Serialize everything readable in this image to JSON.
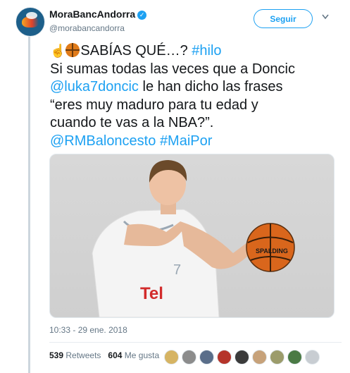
{
  "author": {
    "display_name": "MoraBancAndorra",
    "handle": "@morabancandorra",
    "verified_icon": "verified-badge-icon"
  },
  "follow_label": "Seguir",
  "tweet": {
    "line1_text": "SABÍAS QUÉ…?",
    "line1_hashtag": "#hilo",
    "line2": "Si sumas todas las veces que a Doncic",
    "line3_mention": "@luka7doncic",
    "line3_text": " le han dicho las frases",
    "line4": "“eres muy maduro para tu edad y",
    "line5": "cuando te vas a la NBA?”.",
    "line6_mention": "@RMBaloncesto",
    "line6_hashtag": "#MaiPor",
    "emoji_icons": [
      "pointing-up-icon",
      "basketball-icon"
    ]
  },
  "image": {
    "ball_text": "SPALDING",
    "jersey_number": "7",
    "jersey_sponsor": "Tel"
  },
  "timestamp": "10:33 - 29 ene. 2018",
  "stats": {
    "retweets_count": "539",
    "retweets_label": "Retweets",
    "likes_count": "604",
    "likes_label": "Me gusta"
  },
  "colors": {
    "accent": "#1da1f2",
    "text": "#14171a",
    "muted": "#657786"
  },
  "likers": [
    "#d6b463",
    "#8c8c8c",
    "#5a6e8a",
    "#b5342a",
    "#3b3b3b",
    "#c7a27a",
    "#9c9c6b",
    "#4a7a45",
    "#c8cdd2"
  ]
}
